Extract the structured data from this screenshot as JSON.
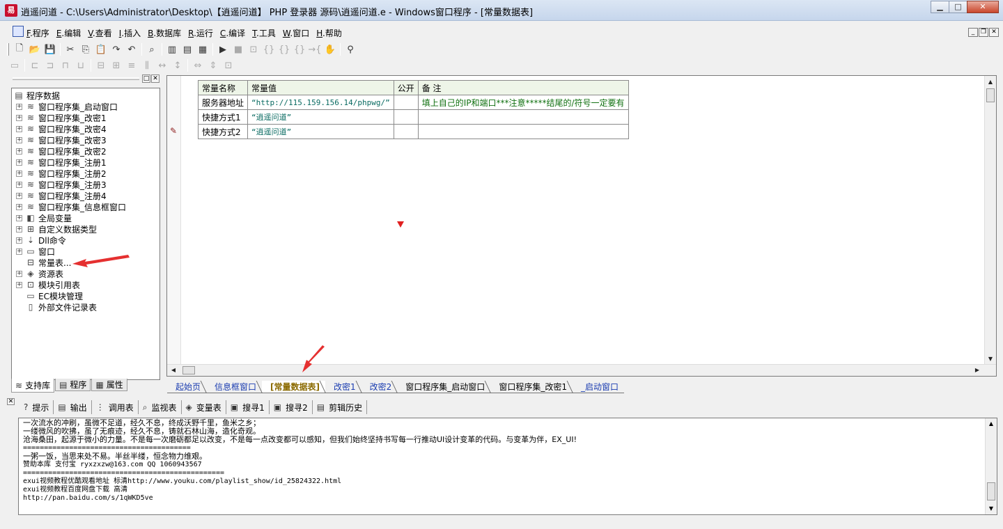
{
  "window": {
    "title": "逍遥问道 - C:\\Users\\Administrator\\Desktop\\【逍遥问道】 PHP 登录器 源码\\逍遥问道.e - Windows窗口程序 - [常量数据表]",
    "minimize": "▁",
    "maximize": "□",
    "close": "✕"
  },
  "menu": [
    {
      "key": "F",
      "label": ".程序"
    },
    {
      "key": "E",
      "label": ".编辑"
    },
    {
      "key": "V",
      "label": ".查看"
    },
    {
      "key": "I",
      "label": ".插入"
    },
    {
      "key": "B",
      "label": ".数据库"
    },
    {
      "key": "R",
      "label": ".运行"
    },
    {
      "key": "C",
      "label": ".编译"
    },
    {
      "key": "T",
      "label": ".工具"
    },
    {
      "key": "W",
      "label": ".窗口"
    },
    {
      "key": "H",
      "label": ".帮助"
    }
  ],
  "tree": [
    {
      "label": "程序数据",
      "exp": "",
      "icon": "▤"
    },
    {
      "label": "窗口程序集_启动窗口",
      "exp": "+",
      "icon": "≋"
    },
    {
      "label": "窗口程序集_改密1",
      "exp": "+",
      "icon": "≋"
    },
    {
      "label": "窗口程序集_改密4",
      "exp": "+",
      "icon": "≋"
    },
    {
      "label": "窗口程序集_改密3",
      "exp": "+",
      "icon": "≋"
    },
    {
      "label": "窗口程序集_改密2",
      "exp": "+",
      "icon": "≋"
    },
    {
      "label": "窗口程序集_注册1",
      "exp": "+",
      "icon": "≋"
    },
    {
      "label": "窗口程序集_注册2",
      "exp": "+",
      "icon": "≋"
    },
    {
      "label": "窗口程序集_注册3",
      "exp": "+",
      "icon": "≋"
    },
    {
      "label": "窗口程序集_注册4",
      "exp": "+",
      "icon": "≋"
    },
    {
      "label": "窗口程序集_信息框窗口",
      "exp": "+",
      "icon": "≋"
    },
    {
      "label": "全局变量",
      "exp": "+",
      "icon": "◧"
    },
    {
      "label": "自定义数据类型",
      "exp": "+",
      "icon": "⊞"
    },
    {
      "label": "Dll命令",
      "exp": "+",
      "icon": "⇣"
    },
    {
      "label": "窗口",
      "exp": "+",
      "icon": "▭"
    },
    {
      "label": "常量表...",
      "exp": "",
      "icon": "⊟"
    },
    {
      "label": "资源表",
      "exp": "+",
      "icon": "◈"
    },
    {
      "label": "模块引用表",
      "exp": "+",
      "icon": "⊡"
    },
    {
      "label": "EC模块管理",
      "exp": "",
      "icon": "▭"
    },
    {
      "label": "外部文件记录表",
      "exp": "",
      "icon": "▯"
    }
  ],
  "left_tabs": [
    {
      "label": "支持库",
      "icon": "≋"
    },
    {
      "label": "程序",
      "icon": "▤"
    },
    {
      "label": "属性",
      "icon": "▦"
    }
  ],
  "const_table": {
    "headers": [
      "常量名称",
      "常量值",
      "公开",
      "备 注"
    ],
    "rows": [
      {
        "name": "服务器地址",
        "value": "“http://115.159.156.14/phpwg/”",
        "public": "",
        "note": "填上自己的IP和端口***注意*****结尾的/符号一定要有"
      },
      {
        "name": "快捷方式1",
        "value": "“逍遥问道”",
        "public": "",
        "note": ""
      },
      {
        "name": "快捷方式2",
        "value": "“逍遥问道”",
        "public": "",
        "note": ""
      }
    ]
  },
  "editor_tabs": [
    {
      "label": "起始页",
      "style": "blue"
    },
    {
      "label": "信息框窗口",
      "style": "blue"
    },
    {
      "label": "[常量数据表]",
      "style": "active"
    },
    {
      "label": "改密1",
      "style": "blue"
    },
    {
      "label": "改密2",
      "style": "blue"
    },
    {
      "label": "窗口程序集_启动窗口",
      "style": "dark"
    },
    {
      "label": "窗口程序集_改密1",
      "style": "dark"
    },
    {
      "label": "_启动窗口",
      "style": "blue"
    }
  ],
  "output_tabs": [
    {
      "label": "提示",
      "icon": "?"
    },
    {
      "label": "输出",
      "icon": "▤"
    },
    {
      "label": "调用表",
      "icon": "⋮"
    },
    {
      "label": "监视表",
      "icon": "⌕"
    },
    {
      "label": "变量表",
      "icon": "◈"
    },
    {
      "label": "搜寻1",
      "icon": "▣"
    },
    {
      "label": "搜寻2",
      "icon": "▣"
    },
    {
      "label": "剪辑历史",
      "icon": "▤"
    }
  ],
  "output_lines": [
    "一次流水的冲刷，虽微不足道，经久不息，终成沃野千里，鱼米之乡；",
    "一缕微风的吹拂，虽了无痕迹，经久不息，铸就石林山海，造化奇观。",
    "沧海桑田，起源于微小的力量。不是每一次磨砺都足以改变，不是每一点改变都可以感知，但我们始终坚持书写每一行推动UI设计变革的代码。与变革为伴，EX_UI!",
    "========================================",
    "一粥一饭，当思来处不易。半丝半缕，恒念物力维艰。",
    "赞助本库 支付宝 ryxzxzw@163.com QQ 1060943567",
    "================================================",
    "exui视频教程优酷观看地址 标清http://www.youku.com/playlist_show/id_25824322.html",
    "exui视频教程百度网盘下载 高清",
    "http://pan.baidu.com/s/1qWKD5ve"
  ]
}
